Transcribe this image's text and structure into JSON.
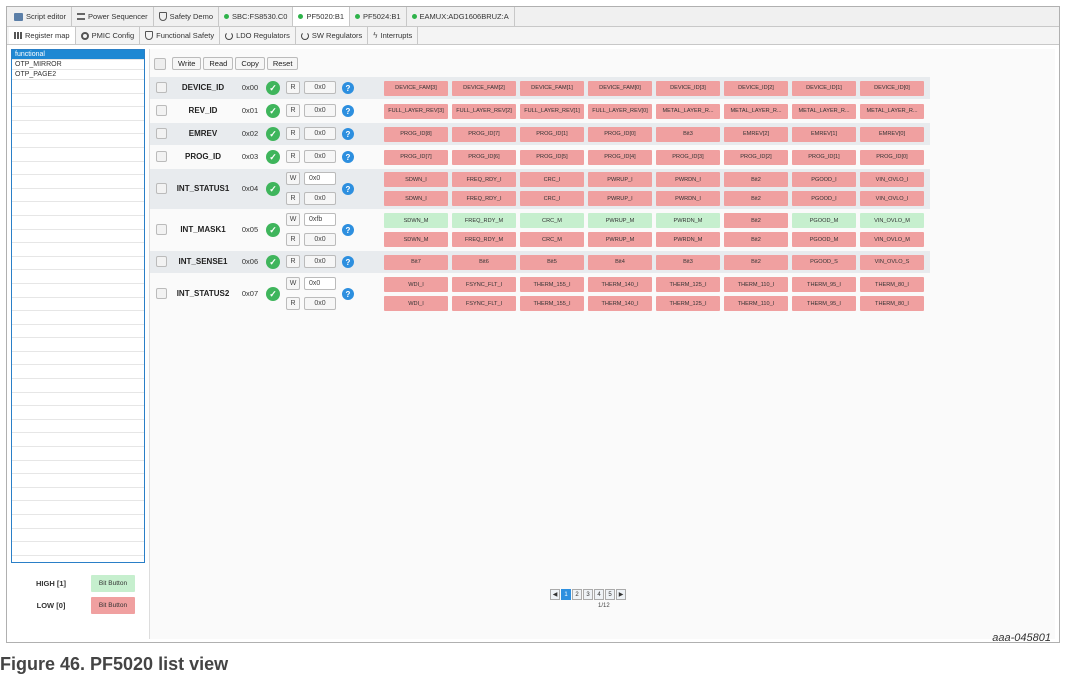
{
  "top_tabs": [
    {
      "label": "Script editor",
      "icon": "script-icon"
    },
    {
      "label": "Power Sequencer",
      "icon": "list-icon"
    },
    {
      "label": "Safety Demo",
      "icon": "shield-icon"
    },
    {
      "label": "SBC:FS8530.C0",
      "icon": "status-dot-icon"
    },
    {
      "label": "PF5020:B1",
      "icon": "status-dot-icon"
    },
    {
      "label": "PF5024:B1",
      "icon": "status-dot-icon"
    },
    {
      "label": "EAMUX:ADG1606BRUZ:A",
      "icon": "status-dot-icon"
    }
  ],
  "sub_tabs": [
    {
      "label": "Register map",
      "icon": "grid-icon"
    },
    {
      "label": "PMIC Config",
      "icon": "gear-icon"
    },
    {
      "label": "Functional Safety",
      "icon": "shield-icon"
    },
    {
      "label": "LDO Regulators",
      "icon": "power-icon"
    },
    {
      "label": "SW Regulators",
      "icon": "power-icon"
    },
    {
      "label": "Interrupts",
      "icon": "bolt-icon"
    }
  ],
  "left_list": [
    "functional",
    "OTP_MIRROR",
    "OTP_PAGE2"
  ],
  "legend": {
    "high_label": "HIGH [1]",
    "high_button": "Bit Button",
    "low_label": "LOW [0]",
    "low_button": "Bit Button"
  },
  "toolbar": {
    "write": "Write",
    "read": "Read",
    "copy": "Copy",
    "reset": "Reset"
  },
  "colors": {
    "bit_low": "#f0a0a0",
    "bit_high": "#c6efce",
    "accent": "#2d8fdf",
    "ok": "#3fb55c"
  },
  "registers": [
    {
      "name": "DEVICE_ID",
      "addr": "0x00",
      "read_value": "0x0",
      "read_bits": [
        "DEVICE_FAM[3]",
        "DEVICE_FAM[2]",
        "DEVICE_FAM[1]",
        "DEVICE_FAM[0]",
        "DEVICE_ID[3]",
        "DEVICE_ID[2]",
        "DEVICE_ID[1]",
        "DEVICE_ID[0]"
      ]
    },
    {
      "name": "REV_ID",
      "addr": "0x01",
      "read_value": "0x0",
      "read_bits": [
        "FULL_LAYER_REV[3]",
        "FULL_LAYER_REV[2]",
        "FULL_LAYER_REV[1]",
        "FULL_LAYER_REV[0]",
        "METAL_LAYER_R...",
        "METAL_LAYER_R...",
        "METAL_LAYER_R...",
        "METAL_LAYER_R..."
      ]
    },
    {
      "name": "EMREV",
      "addr": "0x02",
      "read_value": "0x0",
      "read_bits": [
        "PROG_ID[8]",
        "PROG_ID[7]",
        "PROG_ID[1]",
        "PROG_ID[0]",
        "Bit3",
        "EMREV[2]",
        "EMREV[1]",
        "EMREV[0]"
      ]
    },
    {
      "name": "PROG_ID",
      "addr": "0x03",
      "read_value": "0x0",
      "read_bits": [
        "PROG_ID[7]",
        "PROG_ID[6]",
        "PROG_ID[5]",
        "PROG_ID[4]",
        "PROG_ID[3]",
        "PROG_ID[2]",
        "PROG_ID[1]",
        "PROG_ID[0]"
      ]
    },
    {
      "name": "INT_STATUS1",
      "addr": "0x04",
      "write_value": "0x0",
      "read_value": "0x0",
      "write_bits": [
        "SDWN_I",
        "FREQ_RDY_I",
        "CRC_I",
        "PWRUP_I",
        "PWRDN_I",
        "Bit2",
        "PGOOD_I",
        "VIN_OVLO_I"
      ],
      "read_bits": [
        "SDWN_I",
        "FREQ_RDY_I",
        "CRC_I",
        "PWRUP_I",
        "PWRDN_I",
        "Bit2",
        "PGOOD_I",
        "VIN_OVLO_I"
      ]
    },
    {
      "name": "INT_MASK1",
      "addr": "0x05",
      "write_value": "0xfb",
      "read_value": "0x0",
      "write_bits": [
        "SDWN_M",
        "FREQ_RDY_M",
        "CRC_M",
        "PWRUP_M",
        "PWRDN_M",
        "Bit2",
        "PGOOD_M",
        "VIN_OVLO_M"
      ],
      "write_states": [
        1,
        1,
        1,
        1,
        1,
        0,
        1,
        1
      ],
      "read_bits": [
        "SDWN_M",
        "FREQ_RDY_M",
        "CRC_M",
        "PWRUP_M",
        "PWRDN_M",
        "Bit2",
        "PGOOD_M",
        "VIN_OVLO_M"
      ]
    },
    {
      "name": "INT_SENSE1",
      "addr": "0x06",
      "read_value": "0x0",
      "read_bits": [
        "Bit7",
        "Bit6",
        "Bit5",
        "Bit4",
        "Bit3",
        "Bit2",
        "PGOOD_S",
        "VIN_OVLO_S"
      ]
    },
    {
      "name": "INT_STATUS2",
      "addr": "0x07",
      "write_value": "0x0",
      "read_value": "0x0",
      "write_bits": [
        "WDI_I",
        "FSYNC_FLT_I",
        "THERM_155_I",
        "THERM_140_I",
        "THERM_125_I",
        "THERM_110_I",
        "THERM_95_I",
        "THERM_80_I"
      ],
      "read_bits": [
        "WDI_I",
        "FSYNC_FLT_I",
        "THERM_155_I",
        "THERM_140_I",
        "THERM_125_I",
        "THERM_110_I",
        "THERM_95_I",
        "THERM_80_I"
      ]
    }
  ],
  "pagination": {
    "pages": [
      "1",
      "2",
      "3",
      "4",
      "5"
    ],
    "current": "1/12"
  },
  "figure_id": "aaa-045801",
  "caption": "Figure 46.  PF5020 list view"
}
